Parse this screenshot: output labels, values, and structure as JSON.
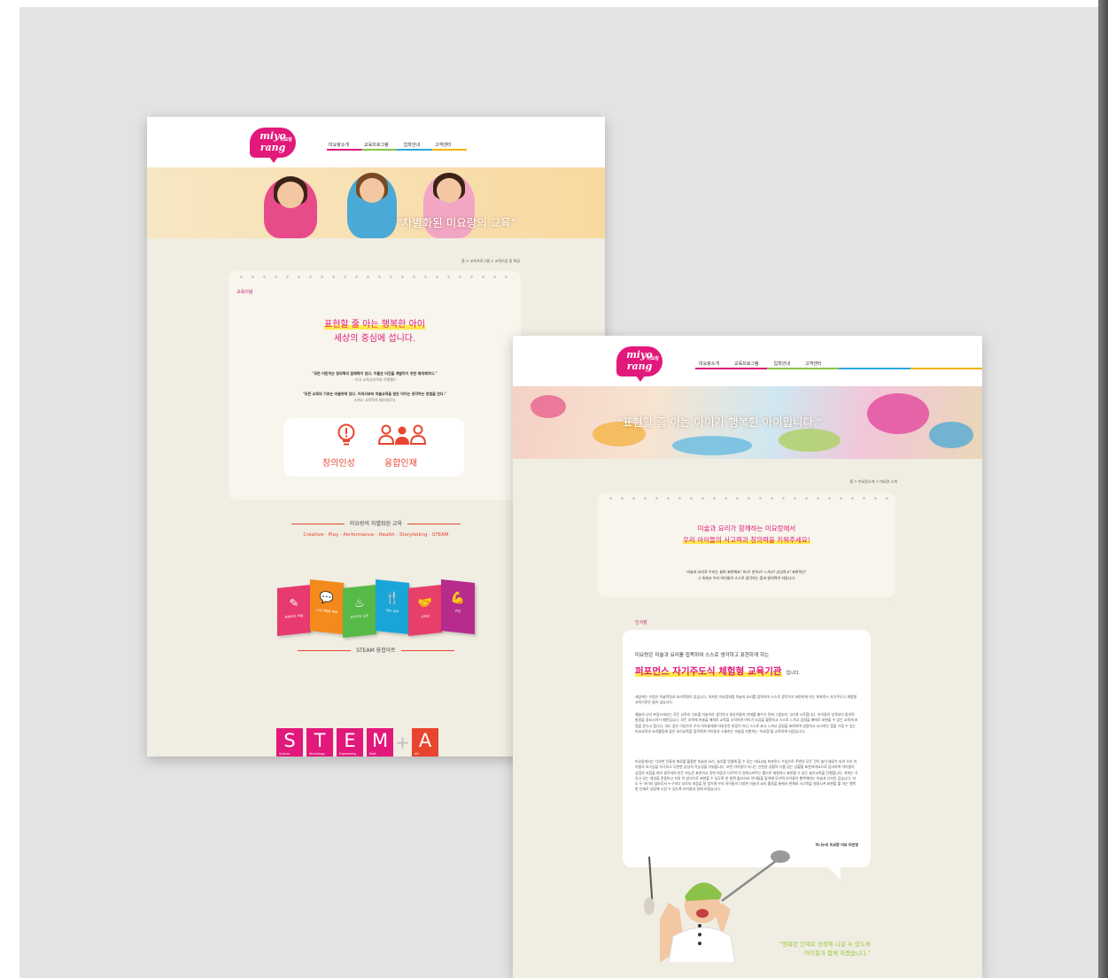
{
  "page1": {
    "nav": [
      "미요랑소개",
      "교육프로그램",
      "입학안내",
      "고객센터"
    ],
    "banner_text": "\"차별화된 미요랑의 교육\"",
    "breadcrumb": "홈 > 교육프로그램 > 교육이념 및 특징",
    "section_label": "교육이념",
    "headline_1": "표현할 줄 아는 행복한 아이",
    "headline_2": "세상의 중심에 섭니다.",
    "quote1": "\"모든 어린이는 창의력의 잠재력이 있다. 이들은 미진을 계발하기 위한 매개체이다.\"",
    "quote1_src": "- 미국 교육심리학자 로웬펠드",
    "quote2": "\"모든 교육의 기초는 미술위에 있다. 어려서부터 미술교육을 받은 아이는 생각하는 방법을 안다.\"",
    "quote2_src": "스위스 교육학자 페스탈로치",
    "value1": "창의인성",
    "value2": "융합인재",
    "diff_title": "미요랑의 차별화된 교육",
    "keywords": "Creative · Play · Performance · Health · Storytelling · STEAM",
    "panels": [
      "표현하는 미술",
      "스토리텔링 재료",
      "요리하는 요리",
      "미트 요리",
      "사회성",
      "건강"
    ],
    "steam_title": "STEAM 융합아트",
    "steam_letters": [
      "S",
      "T",
      "E",
      "M",
      "A"
    ],
    "steam_words": [
      "Science",
      "Technology",
      "Engineering",
      "Math",
      "Art"
    ]
  },
  "page2": {
    "nav": [
      "미요랑소개",
      "교육프로그램",
      "입학안내",
      "고객센터"
    ],
    "banner_text": "\"표현할 줄 아는 아이가 행복한 아이입니다.\"",
    "breadcrumb": "홈 > 미요랑소개 > 미요랑 소개",
    "headline_1": "미술과 요리가 함께하는 미요랑에서",
    "headline_2": "우리 아이들의 사고력과 창의력을 키워주세요!",
    "intro_1": "미술과 요리로 우리는 놀며 표현해요! 보고! 만지고! 느끼고! 상상하고! 표현하는!",
    "intro_2": "그 속에서 우리 아이들이 스스로 생각하는 힘과 창의력이 자랍니다.",
    "section_label": "인사말",
    "greet_lead": "미요랑은 미술과 요리를 접목하여 스스로 생각하고 표현하게 하는",
    "greet_main": "퍼포먼스 자기주도식 체험형 교육기관",
    "greet_suffix": "입니다.",
    "p1": "세상에는 수많은 미술학원과 요리학원이 있습니다. 하지만 미요랑처럼 미술과 요리를 접목하여 스스로 생각하고 표현하게 하는 퍼포먼스 자기주도식 체험형 교육기관은 쉽지 않습니다.",
    "p2": "예술의 나라 프랑스에서는 모든 교육의 기초를 미술이라 생각하고 영유아들의 연애를 배우기 전에 그림부터 그리게 시작합니다. 아이들의 성격보다 창의적 발달을 중요시하기 때문입니다. 모든 과목에 미술을 매개로 교육을 시작하여 아이가 오감을 활용하고 스스로 느끼고 감정을 배에로 표현할 수 있는 교육에 초점을 둔다고 합니다. 저도 같은 이념으로 우리 아이들에게 자유로운 마음이 아닌 스스로 표고 느끼고 감정을 표현하며 성장하고 사고하는 힘을 가질 수 있는 미요교육과 요리활동에 좋은 요리교육을 접목하여 아이들과 소통하는 미술을 지향하는 '미요랑'을 교육하게 되었습니다.",
    "p3": "미요랑에서는 다양한 전통과 재료를 활용한 미술과 요리, 놀이를 연결해 할 수 있는 미요교실 퍼포먼스 수업으로 주변의 모든 것이 놀이 재료가 되어 우리 아이들의 호기심을 자극하고 무한한 상상의 가능성을 키워줍니다. 또한 아이들이 티나는 선한성 상황의 다름 있는 상황할 표현하여요으로 감사하며 아이들의 상점의 지점을 여러 생각하여 만든 자능은 표현하고 강한 마음은 다르며 이 강화시켜주는 틀으로 체험하고 표현할 수 있는 놀이교육을 진행합니다. 저희는 가치고 있는 개성을 존중하고 자의 의 방식으로 표현할 수 있도록 한 발짝 물러서서 아이들을 탐색해 모으며 아이들이 행복해하는 미술과 디자인 갑습니다. 저도 두 아이의 엄마로서 누구보다 부모의 마음을 잘 알기에 우리 아이들이 다양한 미술과 요리 활동을 통해서 한계와 사고력을 발달시켜 표현할 줄 아는 행복한 인재로 성장해 나갈 수 있도록 아이들과 함께 하겠습니다.",
    "signature": "미니누리 미요랑 미요 미연영",
    "bottom_line1": "\"행복한 인재로 성장해 나갈 수 있도록",
    "bottom_line2": "아이들과 함께 하겠습니다.\""
  },
  "logo": {
    "wordmark": "miyo rang",
    "small": "미요랑"
  },
  "colors": {
    "brand": "#e2187a",
    "accent": "#e8452f",
    "bg": "#e3e3e4",
    "cream": "#f0ede2"
  }
}
